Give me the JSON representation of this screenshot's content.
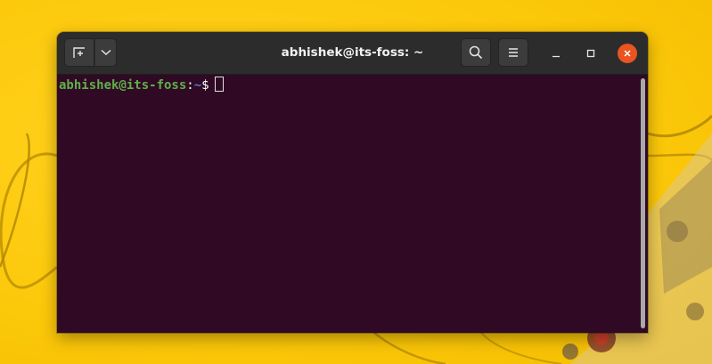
{
  "window": {
    "title": "abhishek@its-foss: ~"
  },
  "headerbar": {
    "new_tab_icon": "new-tab-icon",
    "tab_menu_icon": "chevron-down-icon",
    "search_icon": "search-icon",
    "menu_icon": "hamburger-menu-icon",
    "minimize_icon": "minimize-icon",
    "maximize_icon": "maximize-icon",
    "close_icon": "close-icon"
  },
  "terminal": {
    "user_host": "abhishek@its-foss",
    "separator": ":",
    "path": "~",
    "dollar": "$"
  },
  "colors": {
    "terminal_bg": "#300a24",
    "headerbar_bg": "#2c2c2c",
    "close_button": "#e95420",
    "prompt_user": "#5fb04a",
    "prompt_path": "#4f7fcf",
    "wallpaper": "#fcc80a"
  }
}
